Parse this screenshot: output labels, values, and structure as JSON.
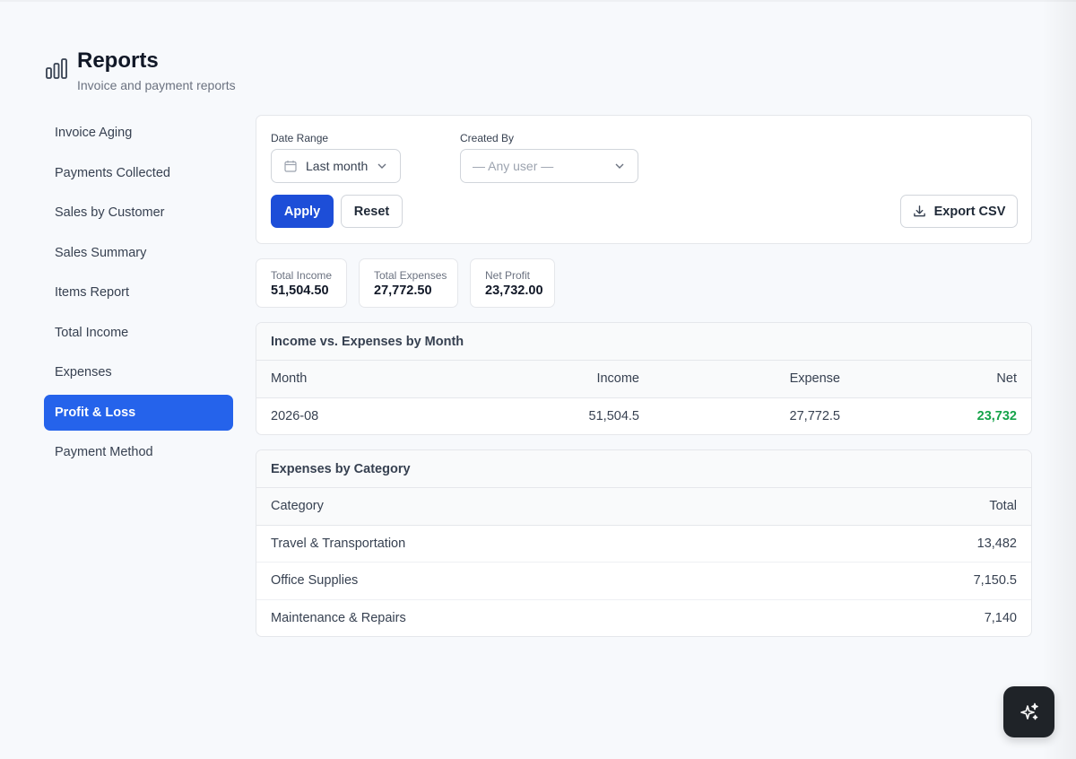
{
  "header": {
    "title": "Reports",
    "subtitle": "Invoice and payment reports",
    "icon": "bar-chart-icon"
  },
  "sidebar": {
    "items": [
      {
        "label": "Invoice Aging",
        "active": false
      },
      {
        "label": "Payments Collected",
        "active": false
      },
      {
        "label": "Sales by Customer",
        "active": false
      },
      {
        "label": "Sales Summary",
        "active": false
      },
      {
        "label": "Items Report",
        "active": false
      },
      {
        "label": "Total Income",
        "active": false
      },
      {
        "label": "Expenses",
        "active": false
      },
      {
        "label": "Profit & Loss",
        "active": true
      },
      {
        "label": "Payment Method",
        "active": false
      }
    ]
  },
  "filters": {
    "date_range_label": "Date Range",
    "date_range_value": "Last month",
    "created_by_label": "Created By",
    "created_by_placeholder": "— Any user —",
    "apply_label": "Apply",
    "reset_label": "Reset",
    "export_label": "Export CSV"
  },
  "stats": [
    {
      "label": "Total Income",
      "value": "51,504.50"
    },
    {
      "label": "Total Expenses",
      "value": "27,772.50"
    },
    {
      "label": "Net Profit",
      "value": "23,732.00"
    }
  ],
  "monthly_table": {
    "title": "Income vs. Expenses by Month",
    "headers": {
      "month": "Month",
      "income": "Income",
      "expense": "Expense",
      "net": "Net"
    },
    "rows": [
      {
        "month": "2026-08",
        "income": "51,504.5",
        "expense": "27,772.5",
        "net": "23,732"
      }
    ]
  },
  "category_table": {
    "title": "Expenses by Category",
    "headers": {
      "category": "Category",
      "total": "Total"
    },
    "rows": [
      {
        "category": "Travel & Transportation",
        "total": "13,482"
      },
      {
        "category": "Office Supplies",
        "total": "7,150.5"
      },
      {
        "category": "Maintenance & Repairs",
        "total": "7,140"
      }
    ]
  },
  "colors": {
    "primary": "#2563eb",
    "apply_button": "#1d4ed8",
    "positive": "#16a34a",
    "fab": "#1f2328"
  },
  "fab_icon": "sparkles-icon"
}
